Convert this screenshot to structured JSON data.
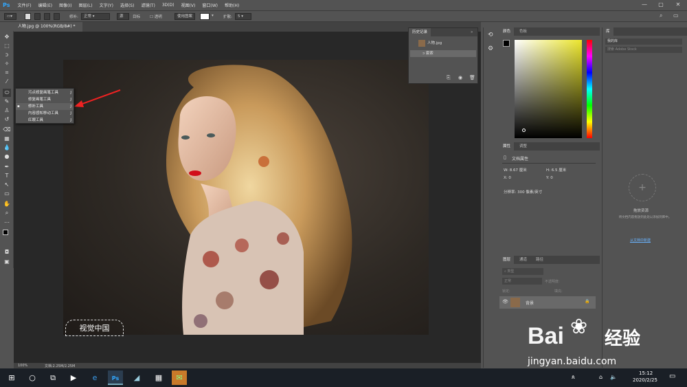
{
  "app": {
    "logo": "Ps"
  },
  "menubar": {
    "items": [
      "文件(F)",
      "编辑(E)",
      "图像(I)",
      "图层(L)",
      "文字(Y)",
      "选择(S)",
      "滤镜(T)",
      "3D(D)",
      "视图(V)",
      "窗口(W)",
      "帮助(H)"
    ],
    "min": "—",
    "max": "▢",
    "close": "✕"
  },
  "options": {
    "blend_label": "修补:",
    "blend_value": "正常",
    "source": "源",
    "target": "目标",
    "transparent": "透明",
    "use_pattern": "使用图案",
    "spread_label": "扩散:",
    "spread_value": "5"
  },
  "document": {
    "tab_title": "人物.jpg @ 100%(RGB/8#) *",
    "close": "×"
  },
  "flyout": {
    "items": [
      {
        "label": "污点修复画笔工具",
        "key": "J",
        "selected": false
      },
      {
        "label": "修复画笔工具",
        "key": "J",
        "selected": false
      },
      {
        "label": "修补工具",
        "key": "J",
        "selected": true
      },
      {
        "label": "内容感知移动工具",
        "key": "J",
        "selected": false
      },
      {
        "label": "红眼工具",
        "key": "J",
        "selected": false
      }
    ]
  },
  "history": {
    "title": "历史记录",
    "items": [
      {
        "label": "人物.jpg"
      },
      {
        "label": "套索"
      }
    ]
  },
  "color": {
    "tabs": [
      "颜色",
      "色板"
    ],
    "hue_color": "#ece62c"
  },
  "properties": {
    "tabs": [
      "属性",
      "调整"
    ],
    "heading": "文档属性",
    "w_label": "W:",
    "w_value": "8.67 厘米",
    "h_label": "H:",
    "h_value": "6.5 厘米",
    "x_label": "X:",
    "x_value": "0",
    "y_label": "Y:",
    "y_value": "0",
    "resolution": "分辨率: 300 像素/英寸"
  },
  "layers": {
    "tabs": [
      "图层",
      "通道",
      "路径"
    ],
    "filter_placeholder": "类型",
    "blend": "正常",
    "opacity_label": "不透明度:",
    "lock_label": "锁定:",
    "fill_label": "填充:",
    "layer_name": "背景"
  },
  "library": {
    "tab": "库",
    "dropdown": "我的库",
    "search_placeholder": "搜索 Adobe Stock",
    "empty_title": "拖放资源",
    "empty_desc": "将文档内容拖放到此处以添加到库中。",
    "learn_more": "从文档中新建"
  },
  "statusbar": {
    "zoom": "100%",
    "doc": "文档:2.25M/2.25M"
  },
  "canvas": {
    "watermark": "视觉中国"
  },
  "taskbar": {
    "time": "15:12",
    "date": "2020/2/25"
  },
  "site_watermark": {
    "brand": "Bai",
    "brand2": "经验",
    "url": "jingyan.baidu.com"
  }
}
